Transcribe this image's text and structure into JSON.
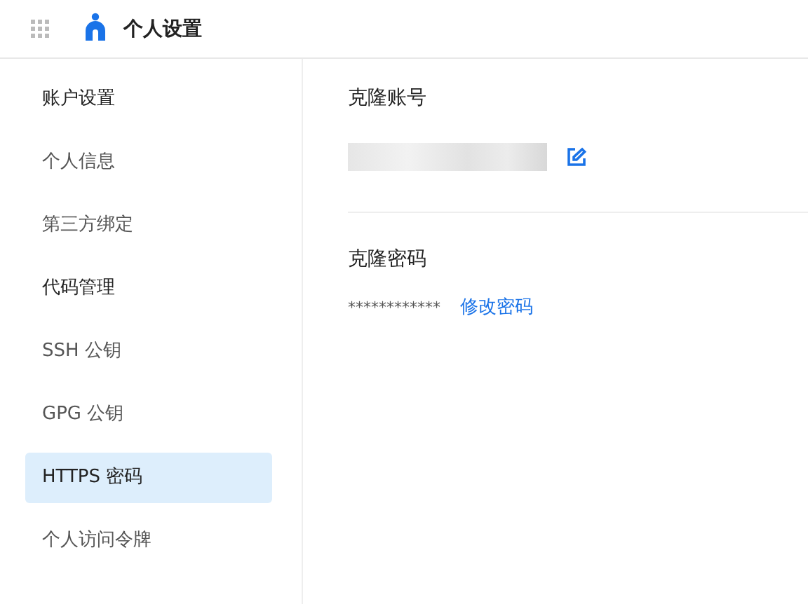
{
  "header": {
    "title": "个人设置"
  },
  "sidebar": {
    "items": [
      {
        "label": "账户设置",
        "kind": "group",
        "selected": false
      },
      {
        "label": "个人信息",
        "kind": "item",
        "selected": false
      },
      {
        "label": "第三方绑定",
        "kind": "item",
        "selected": false
      },
      {
        "label": "代码管理",
        "kind": "group",
        "selected": false
      },
      {
        "label": "SSH 公钥",
        "kind": "item",
        "selected": false
      },
      {
        "label": "GPG 公钥",
        "kind": "item",
        "selected": false
      },
      {
        "label": "HTTPS 密码",
        "kind": "item",
        "selected": true
      },
      {
        "label": "个人访问令牌",
        "kind": "item",
        "selected": false
      }
    ]
  },
  "account": {
    "title": "克隆账号"
  },
  "password": {
    "title": "克隆密码",
    "value": "************",
    "link": "修改密码"
  }
}
